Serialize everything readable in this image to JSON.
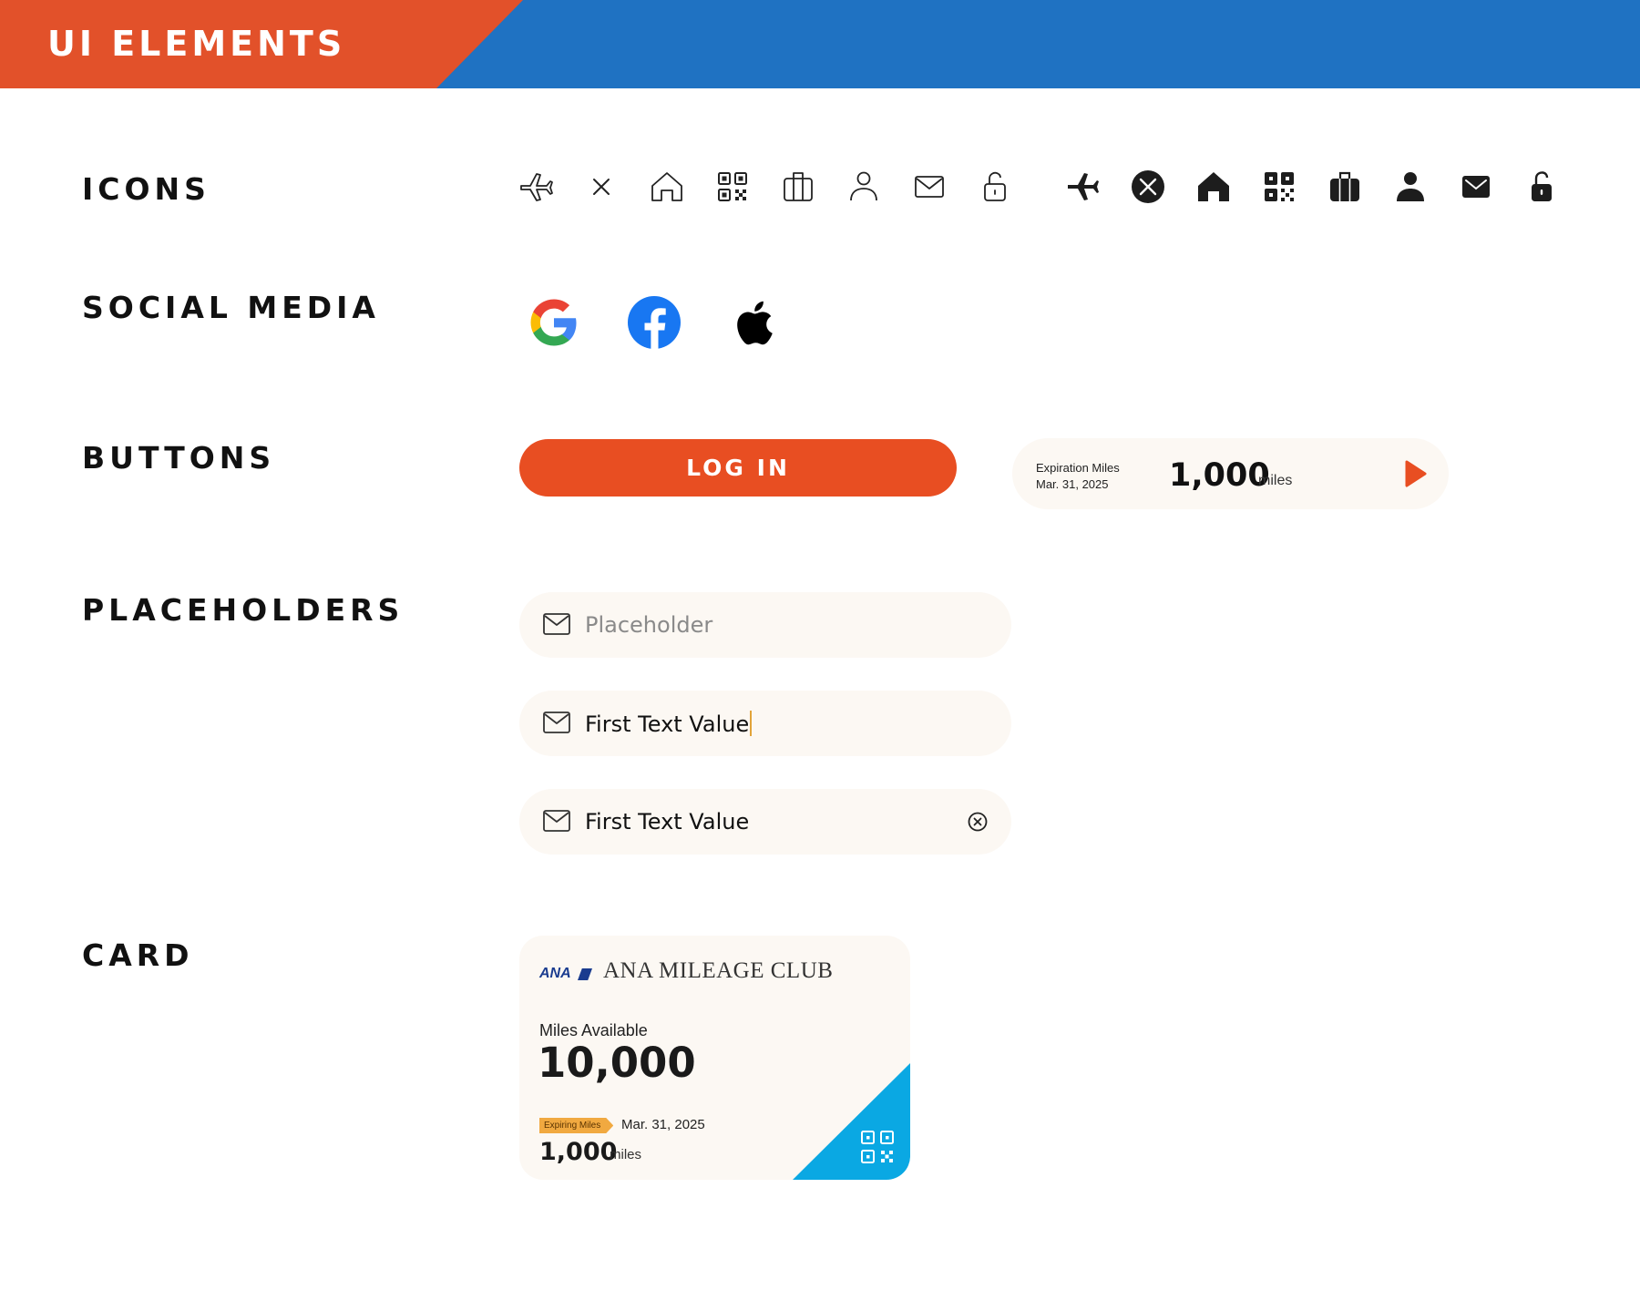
{
  "header": {
    "title": "UI ELEMENTS",
    "colors": {
      "left": "#e2512a",
      "right": "#1f72c2"
    }
  },
  "sections": {
    "icons": "ICONS",
    "social": "SOCIAL MEDIA",
    "buttons": "BUTTONS",
    "placeholders": "PLACEHOLDERS",
    "card": "CARD"
  },
  "icons": {
    "outline": [
      "airplane-icon",
      "close-icon",
      "home-icon",
      "qr-code-icon",
      "luggage-icon",
      "user-icon",
      "mail-icon",
      "unlock-icon"
    ],
    "filled": [
      "airplane-icon",
      "close-circle-icon",
      "home-icon",
      "qr-code-icon",
      "luggage-icon",
      "user-icon",
      "mail-icon",
      "unlock-icon"
    ]
  },
  "social": [
    "google-icon",
    "facebook-icon",
    "apple-icon"
  ],
  "buttons": {
    "login_label": "LOG IN",
    "login_color": "#e84e22",
    "expiration": {
      "label": "Expiration Miles",
      "date": "Mar. 31, 2025",
      "value": "1,000",
      "unit": "miles"
    }
  },
  "inputs": [
    {
      "value": "",
      "placeholder": "Placeholder",
      "state": "empty"
    },
    {
      "value": "First Text Value",
      "placeholder": "Placeholder",
      "state": "focused"
    },
    {
      "value": "First Text Value",
      "placeholder": "Placeholder",
      "state": "filled-clearable"
    }
  ],
  "card": {
    "brand": "ANA",
    "club": "ANA MILEAGE CLUB",
    "miles_label": "Miles Available",
    "miles_value": "10,000",
    "expiring_tag": "Expiring Miles",
    "expiring_date": "Mar. 31, 2025",
    "expiring_value": "1,000",
    "expiring_unit": "miles",
    "accent_color": "#0aa8e3"
  }
}
